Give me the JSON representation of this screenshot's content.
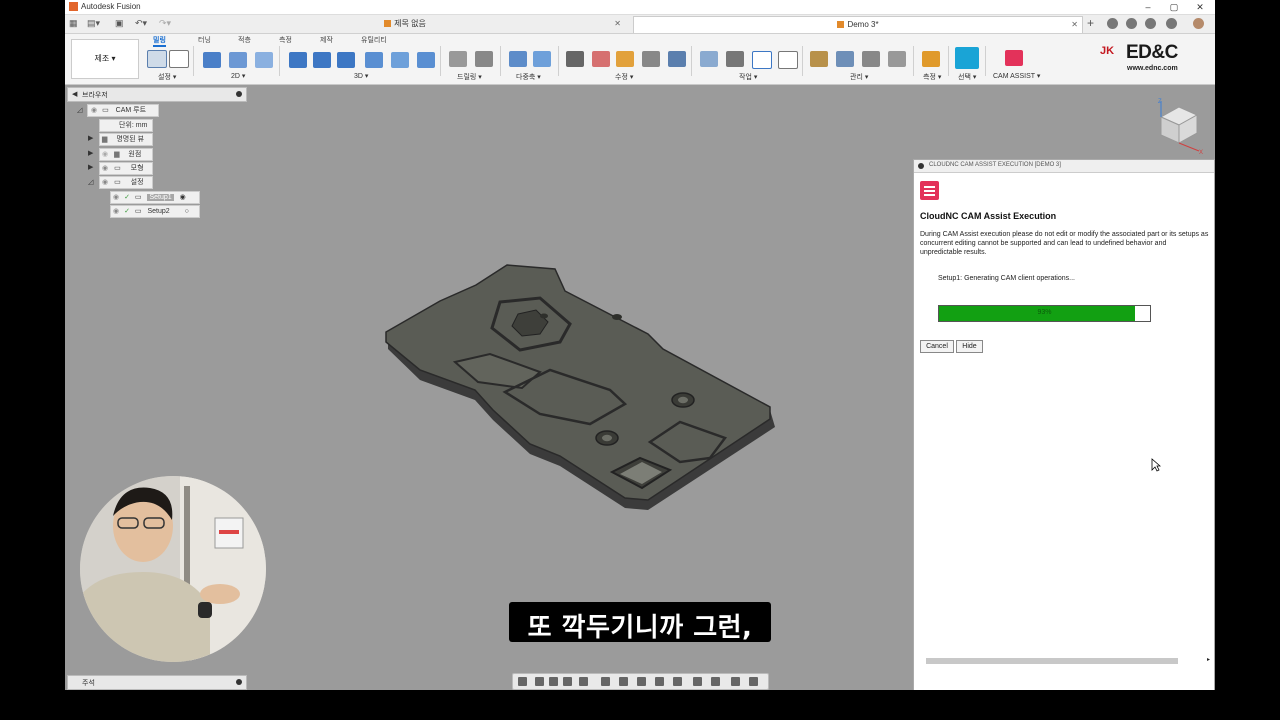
{
  "window": {
    "title": "Autodesk Fusion"
  },
  "tabs": [
    {
      "label": "제목 없음",
      "active": false
    },
    {
      "label": "Demo 3*",
      "active": true
    }
  ],
  "ribbon": {
    "workspace": "제조 ▾",
    "tabs": [
      "밀링",
      "터닝",
      "적층",
      "측정",
      "제작",
      "유틸리티"
    ],
    "groups": [
      "설정 ▾",
      "2D ▾",
      "3D ▾",
      "드릴링 ▾",
      "다중축 ▾",
      "수정 ▾",
      "작업 ▾",
      "관리 ▾",
      "측정 ▾",
      "선택 ▾",
      "CAM ASSIST ▾"
    ]
  },
  "brand": {
    "jk": "JK",
    "name": "ED&C",
    "url": "www.ednc.com"
  },
  "browser": {
    "title": "브라우저",
    "root": "CAM 루트",
    "units": "단위: mm",
    "named_views": "명명된 뷰",
    "origin": "원점",
    "models": "모형",
    "setups": "설정",
    "setup1": "Setup1",
    "setup2": "Setup2"
  },
  "panel": {
    "header": "CLOUDNC CAM ASSIST EXECUTION [DEMO 3]",
    "title": "CloudNC CAM Assist Execution",
    "message": "During CAM Assist execution please do not edit or modify the associated part or its setups as concurrent editing cannot be supported and can lead to undefined behavior and unpredictable results.",
    "status": "Setup1: Generating CAM client operations...",
    "progress": 0.93,
    "progress_label": "93%",
    "cancel": "Cancel",
    "hide": "Hide"
  },
  "comments": {
    "label": "주석"
  },
  "viewcube": {
    "face_label": ""
  },
  "subtitle": "또 깍두기니까 그런,",
  "colors": {
    "accent": "#1a6fd1",
    "progress": "#12a012",
    "cloudnc": "#e3325a",
    "brand_red": "#c41820"
  }
}
